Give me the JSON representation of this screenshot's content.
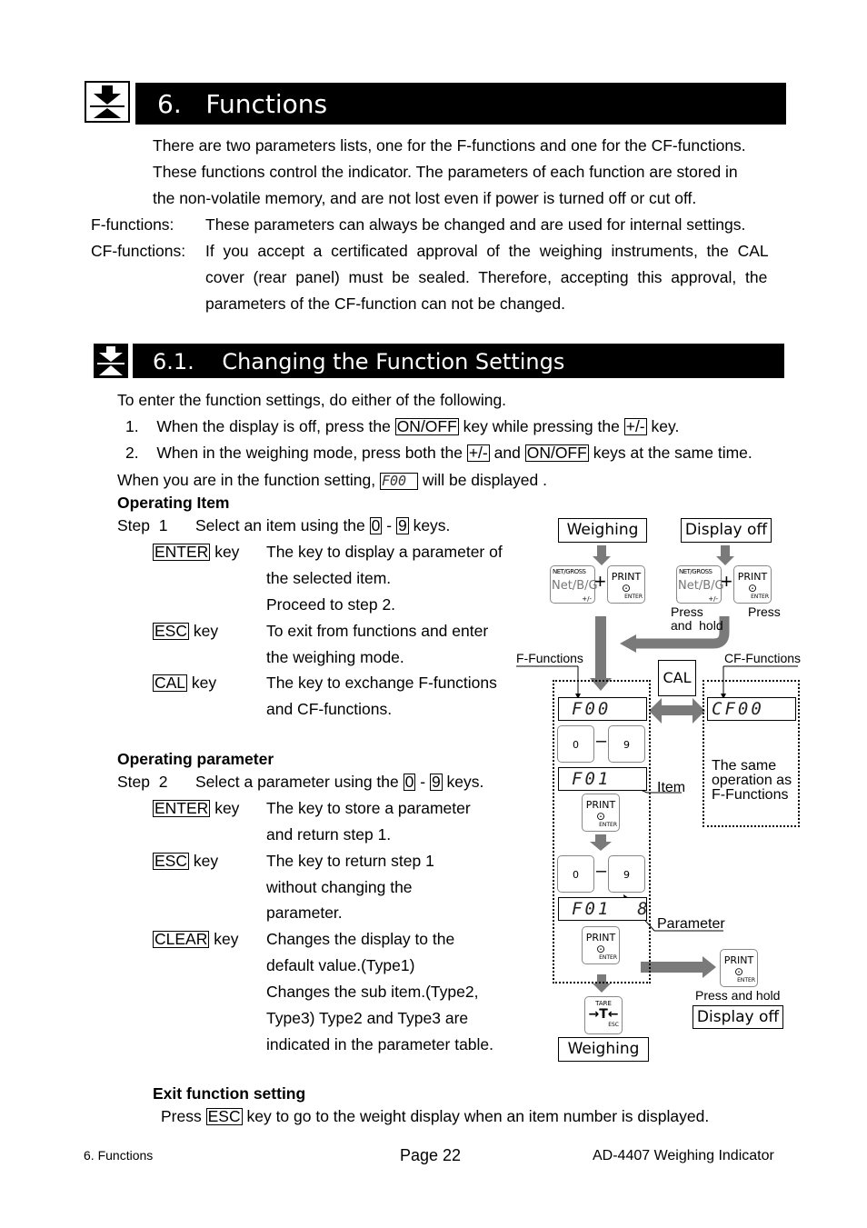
{
  "section6": {
    "title": "6.   Functions",
    "intro": [
      "There are two parameters lists, one for the F-functions and one for the CF-functions.",
      "These functions control the indicator. The parameters of each function are stored in",
      "the non-volatile memory, and are not lost even if power is turned off or cut off."
    ],
    "f_label": "F-functions:",
    "f_text": "These parameters can always be changed and are used for internal settings.",
    "cf_label": "CF-functions:",
    "cf_text": [
      "If  you  accept  a  certificated  approval  of  the  weighing  instruments,  the  CAL",
      "cover  (rear  panel)  must  be  sealed.  Therefore,  accepting  this  approval,  the",
      "parameters of the CF-function can not be changed."
    ]
  },
  "section61": {
    "title": "6.1.    Changing the Function Settings",
    "enter_intro": "To enter the function settings, do either of the following.",
    "item1": {
      "num": "1.",
      "a": "When the display is off, press the",
      "k1": "ON/OFF",
      "b": "key while pressing the",
      "k2": "+/-",
      "c": "key."
    },
    "item2": {
      "num": "2.",
      "a": "When in the weighing mode, press both the",
      "k1": "+/-",
      "b": "and",
      "k2": "ON/OFF",
      "c": "keys at the same time."
    },
    "display_a": "When you are in the function setting,",
    "display_lcd": "F00",
    "display_b": "will be displayed .",
    "operating_item": "Operating Item",
    "step1": {
      "label": "Step  1",
      "a": "Select an item using the",
      "k1": "0",
      "dash": "-",
      "k2": "9",
      "b": "keys."
    },
    "step1_keys": [
      {
        "key": "ENTER",
        "suffix": "key",
        "lines": [
          "The key to display a parameter of",
          "the selected item.",
          "Proceed to step 2."
        ]
      },
      {
        "key": "ESC",
        "suffix": "key",
        "lines": [
          "To exit from functions and enter",
          "the weighing mode."
        ]
      },
      {
        "key": "CAL",
        "suffix": "key",
        "lines": [
          "The key to exchange F-functions",
          "and CF-functions."
        ]
      }
    ],
    "operating_parameter": "Operating parameter",
    "step2": {
      "label": "Step  2",
      "a": "Select a parameter using the",
      "k1": "0",
      "dash": "-",
      "k2": "9",
      "b": "keys."
    },
    "step2_keys": [
      {
        "key": "ENTER",
        "suffix": "key",
        "lines": [
          "The key to store a parameter",
          "and return step 1."
        ]
      },
      {
        "key": "ESC",
        "suffix": "key",
        "lines": [
          "The key to return step 1",
          "without changing the",
          "parameter."
        ]
      },
      {
        "key": "CLEAR",
        "suffix": "key",
        "lines": [
          "Changes the display to the",
          "default value.(Type1)",
          "Changes the sub item.(Type2,",
          "Type3) Type2 and Type3 are",
          "indicated in the parameter table."
        ]
      }
    ],
    "exit_title": "Exit function setting",
    "exit_a": "Press",
    "exit_key": "ESC",
    "exit_b": "key to go to the weight display when an item number is displayed."
  },
  "diagram": {
    "weighing": "Weighing",
    "display_off": "Display off",
    "netgross_top": "NET/GROSS",
    "netgross_main": "Net/B/G",
    "netgross_sub": "+/-",
    "plus": "+",
    "print": "PRINT",
    "print_symbol": "⊙",
    "enter": "ENTER",
    "press_and_hold": "Press\nand  hold",
    "press": "Press",
    "f_functions": "F-Functions",
    "cf_functions": "CF-Functions",
    "cal": "CAL",
    "lcd_f00": "F00",
    "lcd_cf00": "CF00",
    "key0": "0",
    "key9": "9",
    "dash": "–",
    "lcd_f01": "F01",
    "item_label": "Item",
    "same_operation": "The same\noperation as\nF-Functions",
    "lcd_f01_8": "F01  8",
    "parameter_label": "Parameter",
    "press_hold_line": "Press and hold",
    "display_off2": "Display off",
    "tare": "TARE",
    "tare_symbol": "→T←",
    "esc": "ESC",
    "weighing2": "Weighing"
  },
  "footer": {
    "left": "6. Functions",
    "center": "Page 22",
    "right": "AD-4407 Weighing Indicator"
  }
}
